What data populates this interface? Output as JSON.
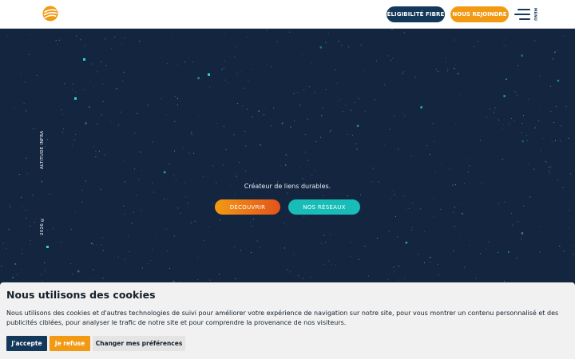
{
  "header": {
    "eligibility_label": "ÉLIGIBILITÉ FIBRE",
    "join_label": "NOUS REJOINDRE",
    "menu_label": "MENU",
    "logo_color": "#f29a14"
  },
  "side": {
    "brand": "ALTITUDE INFRA",
    "year": "2026 ©"
  },
  "hero": {
    "tagline": "Créateur de liens durables.",
    "discover_label": "DÉCOUVRIR",
    "networks_label": "NOS RÉSEAUX"
  },
  "cookie": {
    "title": "Nous utilisons des cookies",
    "text": "Nous utilisons des cookies et d'autres technologies de suivi pour améliorer votre expérience de navigation sur notre site, pour vous montrer un contenu personnalisé et des publicités ciblées, pour analyser le trafic de notre site et pour comprendre la provenance de nos visiteurs.",
    "accept_label": "J'accepte",
    "refuse_label": "Je refuse",
    "prefs_label": "Changer mes préférences"
  },
  "colors": {
    "background": "#142540",
    "navy": "#14385a",
    "orange": "#f29a14",
    "teal": "#18bdb8",
    "star": "#2fd3cf"
  }
}
